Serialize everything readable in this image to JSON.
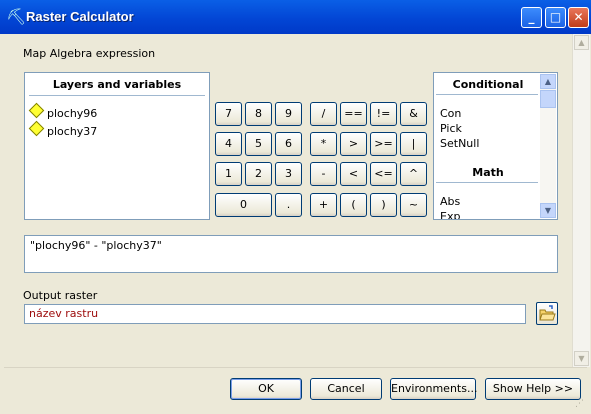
{
  "window": {
    "title": "Raster Calculator",
    "minimize": "_",
    "maximize": "□",
    "close": "✕"
  },
  "labels": {
    "expression": "Map Algebra expression",
    "output": "Output raster"
  },
  "layers_panel": {
    "header": "Layers and variables",
    "items": [
      "plochy96",
      "plochy37"
    ]
  },
  "calculator": {
    "row1": [
      "7",
      "8",
      "9",
      "/",
      "==",
      "!=",
      "&"
    ],
    "row2": [
      "4",
      "5",
      "6",
      "*",
      ">",
      ">=",
      "|"
    ],
    "row3": [
      "1",
      "2",
      "3",
      "-",
      "<",
      "<=",
      "^"
    ],
    "row4": [
      "0",
      ".",
      "+",
      "(",
      ")",
      "~"
    ]
  },
  "functions_panel": {
    "conditional_header": "Conditional",
    "conditional": [
      "Con",
      "Pick",
      "SetNull"
    ],
    "math_header": "Math",
    "math": [
      "Abs",
      "Exp"
    ]
  },
  "expression_text": "\"plochy96\" - \"plochy37\"",
  "output_raster": "název rastru",
  "buttons": {
    "ok": "OK",
    "cancel": "Cancel",
    "environments": "Environments...",
    "show_help": "Show Help >>"
  }
}
